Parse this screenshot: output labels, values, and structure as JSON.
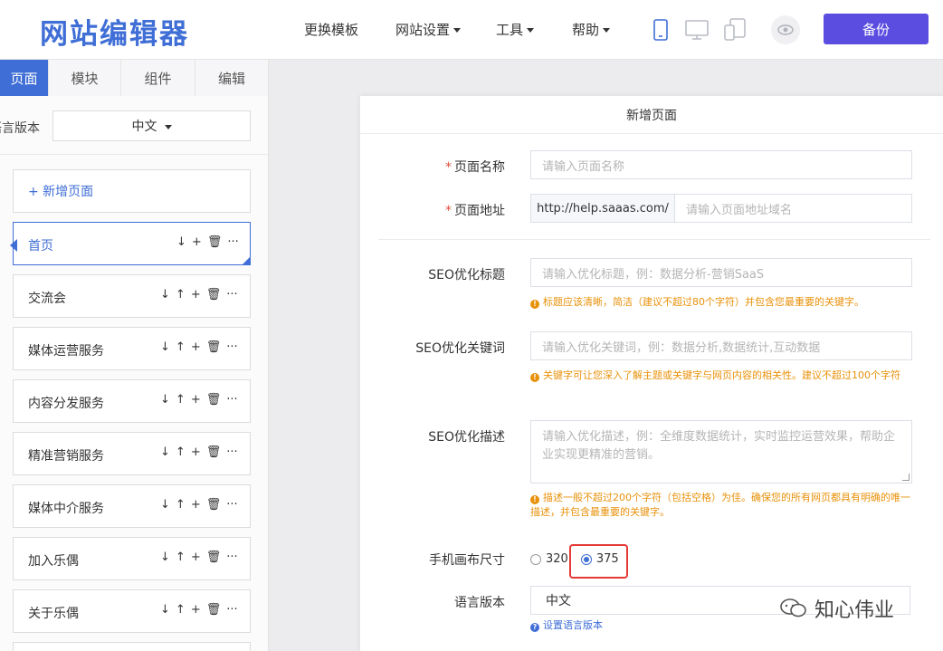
{
  "app": {
    "logo": "网站编辑器"
  },
  "topbar": {
    "menus": [
      {
        "label": "更换模板",
        "has_caret": false
      },
      {
        "label": "网站设置",
        "has_caret": true
      },
      {
        "label": "工具",
        "has_caret": true
      },
      {
        "label": "帮助",
        "has_caret": true
      }
    ],
    "devices": [
      "mobile-icon",
      "desktop-icon",
      "tablet-icon"
    ],
    "preview_icon": "eye-icon",
    "backup_label": "备份",
    "accent": "#5b4de0"
  },
  "sidebar": {
    "tabs": [
      {
        "label": "页面",
        "active": true
      },
      {
        "label": "模块",
        "active": false
      },
      {
        "label": "组件",
        "active": false
      },
      {
        "label": "编辑",
        "active": false
      }
    ],
    "lang_label": "语言版本",
    "lang_value": "中文",
    "add_page_label": "+ 新增页面",
    "pages": [
      {
        "name": "首页",
        "active": true
      },
      {
        "name": "交流会",
        "active": false
      },
      {
        "name": "媒体运营服务",
        "active": false
      },
      {
        "name": "内容分发服务",
        "active": false
      },
      {
        "name": "精准营销服务",
        "active": false
      },
      {
        "name": "媒体中介服务",
        "active": false
      },
      {
        "name": "加入乐偶",
        "active": false
      },
      {
        "name": "关于乐偶",
        "active": false
      }
    ],
    "accent": "#3f6ed6"
  },
  "modal": {
    "title": "新增页面",
    "page_name": {
      "label": "页面名称",
      "placeholder": "请输入页面名称"
    },
    "page_url": {
      "label": "页面地址",
      "prefix": "http://help.saaas.com/",
      "placeholder": "请输入页面地址域名"
    },
    "seo_title": {
      "label": "SEO优化标题",
      "placeholder": "请输入优化标题，例：数据分析-营销SaaS",
      "hint": "标题应该清晰，简洁（建议不超过80个字符）并包含您最重要的关键字。"
    },
    "seo_keywords": {
      "label": "SEO优化关键词",
      "placeholder": "请输入优化关键词，例：数据分析,数据统计,互动数据",
      "hint": "关键字可让您深入了解主题或关键字与网页内容的相关性。建议不超过100个字符"
    },
    "seo_desc": {
      "label": "SEO优化描述",
      "placeholder": "请输入优化描述，例：全维度数据统计，实时监控运营效果，帮助企业实现更精准的营销。",
      "hint": "描述一般不超过200个字符（包括空格）为佳。确保您的所有网页都具有明确的唯一描述，并包含最重要的关键字。"
    },
    "canvas_size": {
      "label": "手机画布尺寸",
      "options": [
        "320",
        "375"
      ],
      "selected": "375"
    },
    "language": {
      "label": "语言版本",
      "value": "中文",
      "hint": "设置语言版本"
    }
  },
  "watermark": "知心伟业"
}
